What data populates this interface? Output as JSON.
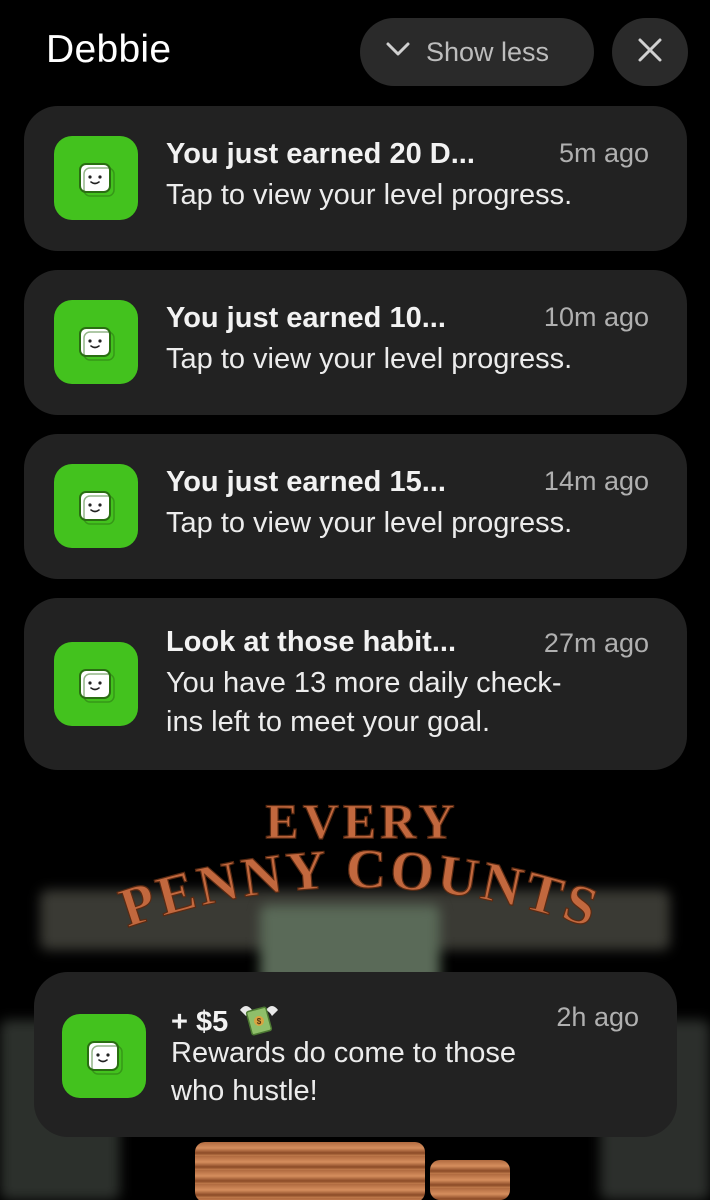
{
  "header": {
    "group_title": "Debbie",
    "show_less_label": "Show less"
  },
  "notifications": [
    {
      "title": "You just earned 20 D...",
      "time": "5m ago",
      "body": "Tap to view your level progress."
    },
    {
      "title": "You just earned 10...",
      "time": "10m ago",
      "body": "Tap to view your level progress."
    },
    {
      "title": "You just earned 15...",
      "time": "14m ago",
      "body": "Tap to view your level progress."
    },
    {
      "title": "Look at those habit...",
      "time": "27m ago",
      "body_line1": "You have 13 more daily check-",
      "body_line2": "ins left to meet your goal."
    },
    {
      "title": "+ $5",
      "title_emoji": "money-with-wings-icon",
      "time": "2h ago",
      "body_line1": "Rewards do come to those",
      "body_line2": "who hustle!"
    }
  ],
  "background": {
    "line1": "EVERY",
    "line2": "PENNY COUNTS"
  },
  "colors": {
    "app_icon": "#43c21e",
    "card": "#222222",
    "poster_text": "#c2683e"
  }
}
